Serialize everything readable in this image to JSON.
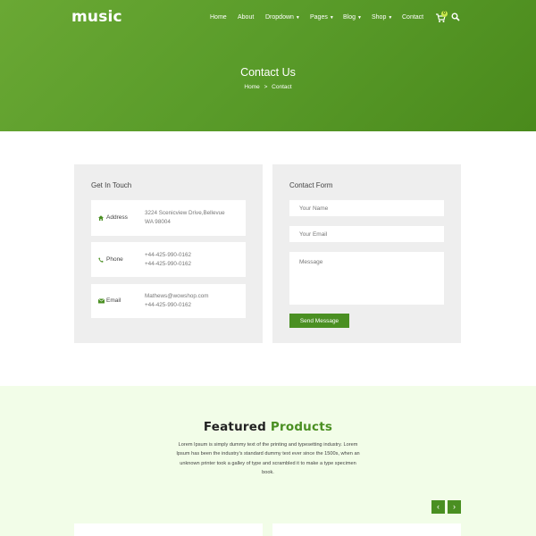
{
  "header": {
    "logo": "music",
    "nav": [
      {
        "label": "Home",
        "caret": false
      },
      {
        "label": "About",
        "caret": false
      },
      {
        "label": "Dropdown",
        "caret": true
      },
      {
        "label": "Pages",
        "caret": true
      },
      {
        "label": "Blog",
        "caret": true
      },
      {
        "label": "Shop",
        "caret": true
      },
      {
        "label": "Contact",
        "caret": false
      }
    ],
    "cart_count": "0",
    "icons": {
      "cart": "cart-icon",
      "search": "search-icon"
    }
  },
  "hero": {
    "title": "Contact Us",
    "breadcrumb": {
      "home": "Home",
      "sep": ">",
      "current": "Contact"
    }
  },
  "contact_info": {
    "title": "Get In Touch",
    "items": [
      {
        "icon": "home-icon",
        "label": "Address",
        "lines": [
          "3224 Scenicview Drive,Bellevue",
          "WA 98004"
        ]
      },
      {
        "icon": "phone-icon",
        "label": "Phone",
        "lines": [
          "+44-425-990-0162",
          "+44-425-990-0162"
        ]
      },
      {
        "icon": "envelope-icon",
        "label": "Email",
        "lines": [
          "Mathews@wowshop.com",
          "+44-425-990-0162"
        ]
      }
    ]
  },
  "contact_form": {
    "title": "Contact Form",
    "name_placeholder": "Your Name",
    "email_placeholder": "Your Email",
    "message_placeholder": "Message",
    "submit_label": "Send Message"
  },
  "featured": {
    "title_part1": "Featured",
    "title_part2": "Products",
    "description": "Lorem Ipsum is simply dummy text of the printing and typesetting industry. Lorem Ipsum has been the industry's standard dummy text ever since the 1500s, when an unknown printer took a galley of type and scrambled it to make a type specimen book.",
    "prev_label": "‹",
    "next_label": "›"
  },
  "colors": {
    "brand_green": "#4a8f22",
    "hero_green": "#5a9c2a",
    "badge_yellow": "#c8e84b",
    "panel_gray": "#eeeeee",
    "featured_bg": "#f2fde8"
  }
}
